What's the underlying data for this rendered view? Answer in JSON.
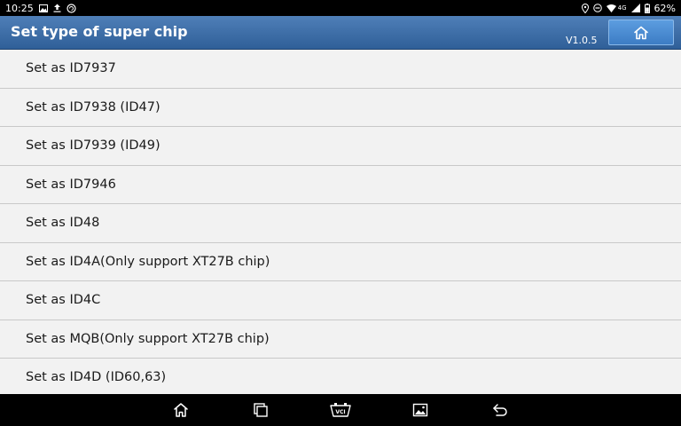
{
  "status_bar": {
    "time": "10:25",
    "network": "4G",
    "battery": "62%"
  },
  "header": {
    "title": "Set type of super chip",
    "version": "V1.0.5",
    "home_icon": "home-icon"
  },
  "items": [
    {
      "label": "Set as ID7937"
    },
    {
      "label": "Set as ID7938 (ID47)"
    },
    {
      "label": "Set as ID7939 (ID49)"
    },
    {
      "label": "Set as ID7946"
    },
    {
      "label": "Set as ID48"
    },
    {
      "label": "Set as ID4A(Only support XT27B chip)"
    },
    {
      "label": "Set as ID4C"
    },
    {
      "label": "Set as MQB(Only support XT27B chip)"
    },
    {
      "label": "Set as ID4D (ID60,63)"
    }
  ],
  "nav_bar": {
    "vci_label": "VCI"
  },
  "colors": {
    "header_top": "#4f7fb8",
    "header_bottom": "#2f5f98",
    "home_button": "#4a8ad2",
    "list_bg": "#f2f2f2",
    "divider": "#c9c9c9"
  }
}
